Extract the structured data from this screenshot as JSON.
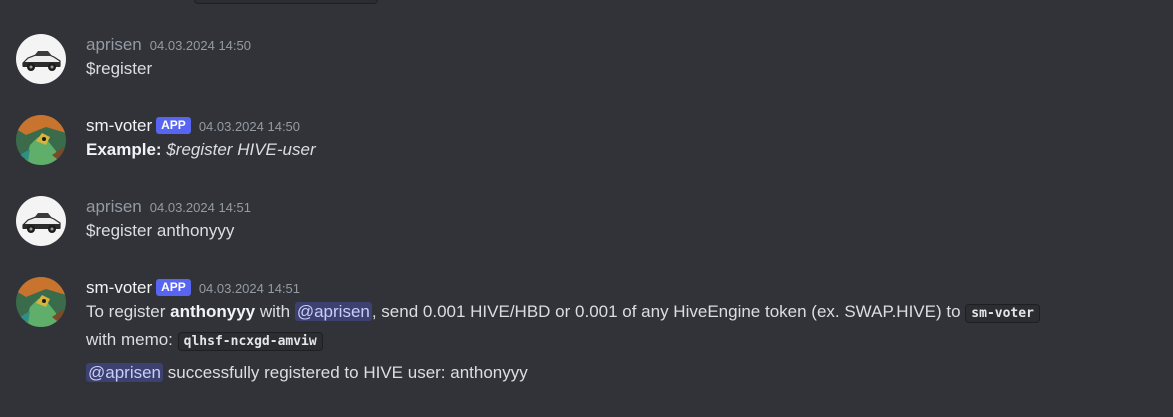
{
  "messages": [
    {
      "username": "aprisen",
      "timestamp": "04.03.2024 14:50",
      "text": "$register"
    },
    {
      "username": "sm-voter",
      "badge": "APP",
      "timestamp": "04.03.2024 14:50",
      "example_label": "Example:",
      "example_text": "$register HIVE-user"
    },
    {
      "username": "aprisen",
      "timestamp": "04.03.2024 14:51",
      "text": "$register anthonyyy"
    },
    {
      "username": "sm-voter",
      "badge": "APP",
      "timestamp": "04.03.2024 14:51",
      "line1_prefix": "To register",
      "line1_user": "anthonyyy",
      "line1_with": "with",
      "line1_mention": "@aprisen",
      "line1_suffix": ", send 0.001 HIVE/HBD or 0.001 of any HiveEngine token (ex. SWAP.HIVE) to",
      "line1_code": "sm-voter",
      "line2_prefix": "with memo:",
      "line2_code": "qlhsf-ncxgd-amviw",
      "line3_mention": "@aprisen",
      "line3_suffix": "successfully registered to HIVE user: anthonyyy"
    }
  ],
  "colors": {
    "background": "#313338",
    "text": "#dbdee1",
    "muted": "#949ba4",
    "badge": "#5865f2",
    "mention_bg": "rgba(88,101,242,0.3)"
  },
  "icons": {
    "aprisen_avatar": "car-avatar-icon",
    "sm_voter_avatar": "dragon-avatar-icon"
  }
}
